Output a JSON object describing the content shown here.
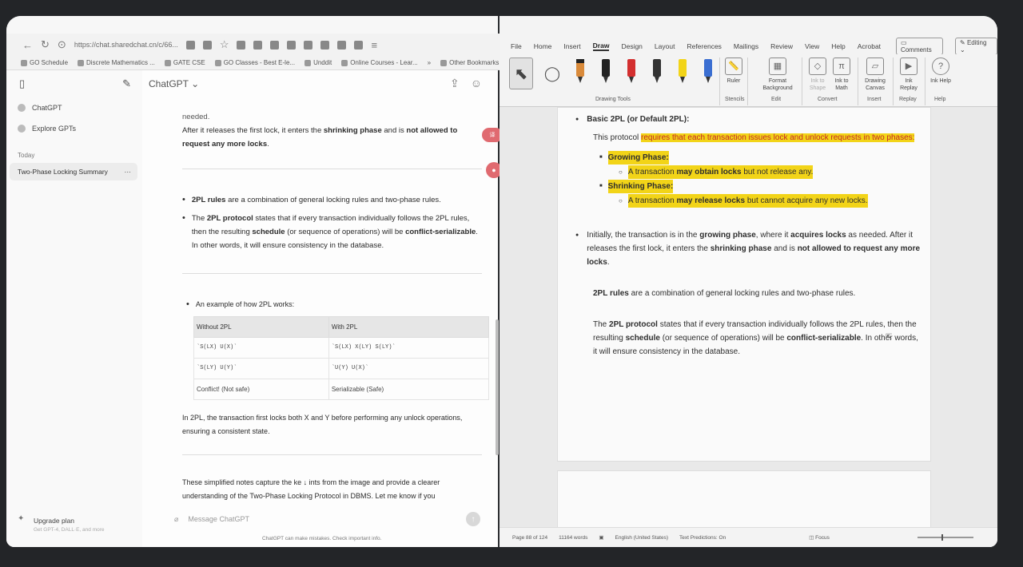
{
  "browser": {
    "url": "https://chat.sharedchat.cn/c/66...",
    "bookmarks": [
      "GO Schedule",
      "Discrete Mathematics ...",
      "GATE CSE",
      "GO Classes - Best E-le...",
      "Unddit",
      "Online Courses - Lear...",
      "Other Bookmarks"
    ]
  },
  "sidebar": {
    "items": [
      {
        "label": "ChatGPT"
      },
      {
        "label": "Explore GPTs"
      }
    ],
    "section": "Today",
    "chat_title": "Two-Phase Locking Summary",
    "upgrade_label": "Upgrade plan",
    "upgrade_sub": "Get GPT-4, DALL·E, and more"
  },
  "chat": {
    "model": "ChatGPT",
    "translate_badge": "译",
    "p1_top": "needed.",
    "p1_a": "After it releases the first lock, it enters the ",
    "p1_b": "shrinking phase",
    "p1_c": " and is ",
    "p1_d": "not allowed to request any more locks",
    "p1_e": ".",
    "b1_a": "2PL rules",
    "b1_b": " are a combination of general locking rules and two-phase rules.",
    "b2_a": "The ",
    "b2_b": "2PL protocol",
    "b2_c": " states that if every transaction individually follows the 2PL rules, then the resulting ",
    "b2_d": "schedule",
    "b2_e": " (or sequence of operations) will be ",
    "b2_f": "conflict-serializable",
    "b2_g": ". In other words, it will ensure consistency in the database.",
    "example_title": "An example of how 2PL works:",
    "table": {
      "headers": [
        "Without 2PL",
        "With 2PL"
      ],
      "rows": [
        [
          "`S(LX) U(X)`",
          "`S(LX) X(LY) S(LY)`"
        ],
        [
          "`S(LY) U(Y)`",
          "`U(Y) U(X)`"
        ],
        [
          "Conflict! (Not safe)",
          "Serializable (Safe)"
        ]
      ]
    },
    "p2": "In 2PL, the transaction first locks both X and Y before performing any unlock operations, ensuring a consistent state.",
    "p3_a": "These simplified notes capture the ke",
    "p3_b": "ints from the image and provide a clearer understanding of the Two-Phase Locking Protocol in DBMS. Let me know if you",
    "placeholder": "Message ChatGPT",
    "disclaimer": "ChatGPT can make mistakes. Check important info."
  },
  "word": {
    "menu": [
      "File",
      "Home",
      "Insert",
      "Draw",
      "Design",
      "Layout",
      "References",
      "Mailings",
      "Review",
      "View",
      "Help",
      "Acrobat"
    ],
    "comments": "Comments",
    "editing": "Editing",
    "ribbon": {
      "drawing_tools": "Drawing Tools",
      "ruler": "Ruler",
      "stencils": "Stencils",
      "format_bg": "Format Background",
      "edit": "Edit",
      "ink_to_shape": "Ink to Shape",
      "ink_to_math": "Ink to Math",
      "convert": "Convert",
      "drawing_canvas": "Drawing Canvas",
      "insert": "Insert",
      "ink_replay": "Ink Replay",
      "replay": "Replay",
      "ink_help": "Ink Help",
      "help": "Help"
    },
    "pen_colors": [
      "#d98a3a",
      "#222222",
      "#d32f2f",
      "#333333",
      "#f2d418",
      "#3a6ed1"
    ],
    "doc": {
      "h1": "Basic 2PL (or Default 2PL):",
      "p_a": "This protocol ",
      "p_b": "requires that each transaction issues lock and unlock requests in two phases:",
      "grow": "Growing Phase:",
      "grow_a": "A transaction ",
      "grow_b": "may obtain locks",
      "grow_c": " but not release any.",
      "shrink": "Shrinking Phase:",
      "shrink_a": "A transaction ",
      "shrink_b": "may release locks",
      "shrink_c": " but cannot acquire any new locks.",
      "i_a": "Initially, the transaction is in the ",
      "i_b": "growing phase",
      "i_c": ", where it ",
      "i_d": "acquires locks",
      "i_e": " as needed. After it releases the first lock, it enters the ",
      "i_f": "shrinking phase",
      "i_g": " and is ",
      "i_h": "not allowed to request any more locks",
      "i_i": ".",
      "r_a": "2PL rules",
      "r_b": " are a combination of general locking rules and two-phase rules.",
      "q_a": "The ",
      "q_b": "2PL protocol",
      "q_c": " states that if every transaction individually follows the 2PL rules, then the resulting ",
      "q_d": "schedule",
      "q_e": " (or sequence of operations) will be ",
      "q_f": "conflict-serializable",
      "q_g": ". In other words, it will ensure consistency in the database."
    },
    "status": {
      "page": "Page 88 of 124",
      "words": "11164 words",
      "language": "English (United States)",
      "predictions": "Text Predictions: On",
      "focus": "Focus"
    }
  }
}
